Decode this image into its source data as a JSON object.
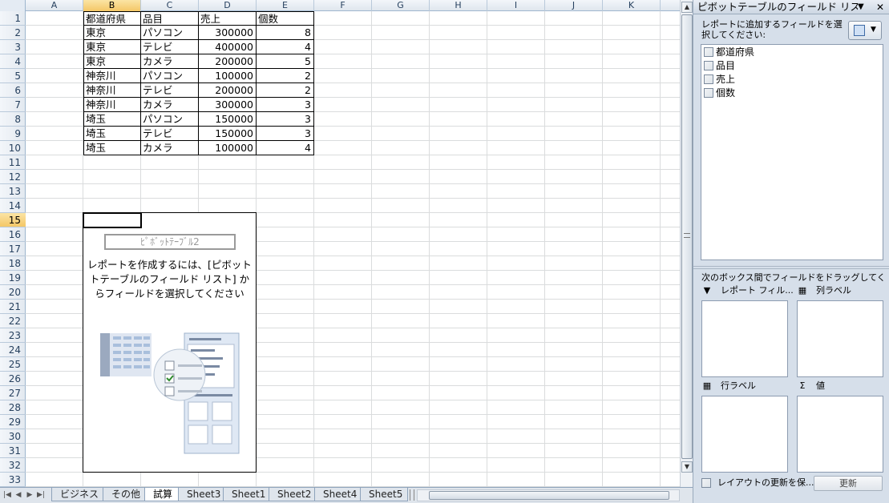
{
  "columns": [
    "A",
    "B",
    "C",
    "D",
    "E",
    "F",
    "G",
    "H",
    "I",
    "J",
    "K"
  ],
  "selected_column": "B",
  "rows": [
    "1",
    "2",
    "3",
    "4",
    "5",
    "6",
    "7",
    "8",
    "9",
    "10",
    "11",
    "12",
    "13",
    "14",
    "15",
    "16",
    "17",
    "18",
    "19",
    "20",
    "21",
    "22",
    "23",
    "24",
    "25",
    "26",
    "27",
    "28",
    "29",
    "30",
    "31",
    "32",
    "33"
  ],
  "selected_row": "15",
  "table": {
    "header": [
      "都道府県",
      "品目",
      "売上",
      "個数"
    ],
    "rows": [
      [
        "東京",
        "パソコン",
        "300000",
        "8"
      ],
      [
        "東京",
        "テレビ",
        "400000",
        "4"
      ],
      [
        "東京",
        "カメラ",
        "200000",
        "5"
      ],
      [
        "神奈川",
        "パソコン",
        "100000",
        "2"
      ],
      [
        "神奈川",
        "テレビ",
        "200000",
        "2"
      ],
      [
        "神奈川",
        "カメラ",
        "300000",
        "3"
      ],
      [
        "埼玉",
        "パソコン",
        "150000",
        "3"
      ],
      [
        "埼玉",
        "テレビ",
        "150000",
        "3"
      ],
      [
        "埼玉",
        "カメラ",
        "100000",
        "4"
      ]
    ]
  },
  "pivot_placeholder": {
    "name": "ﾋﾟﾎﾞｯﾄﾃｰﾌﾞﾙ2",
    "message_lines": [
      "レポートを作成するには、[ピボット",
      "トテーブルのフィールド リスト] か",
      "らフィールドを選択してください"
    ]
  },
  "sheet_tabs": [
    "ビジネス",
    "その他",
    "試算",
    "Sheet3",
    "Sheet1",
    "Sheet2",
    "Sheet4",
    "Sheet5"
  ],
  "active_tab": "試算",
  "field_list": {
    "title": "ピボットテーブルのフィールド リスト",
    "instruction": "レポートに追加するフィールドを選択してください:",
    "fields": [
      "都道府県",
      "品目",
      "売上",
      "個数"
    ],
    "drag_instruction": "次のボックス間でフィールドをドラッグしてください:",
    "zones": {
      "report_filter": "レポート フィル...",
      "column_labels": "列ラベル",
      "row_labels": "行ラベル",
      "values": "値"
    },
    "defer_update_label": "レイアウトの更新を保...",
    "update_button": "更新"
  },
  "colors": {
    "selected_header": "#f4c766",
    "grid": "#dadcdd",
    "panel_bg": "#d6dfea"
  }
}
